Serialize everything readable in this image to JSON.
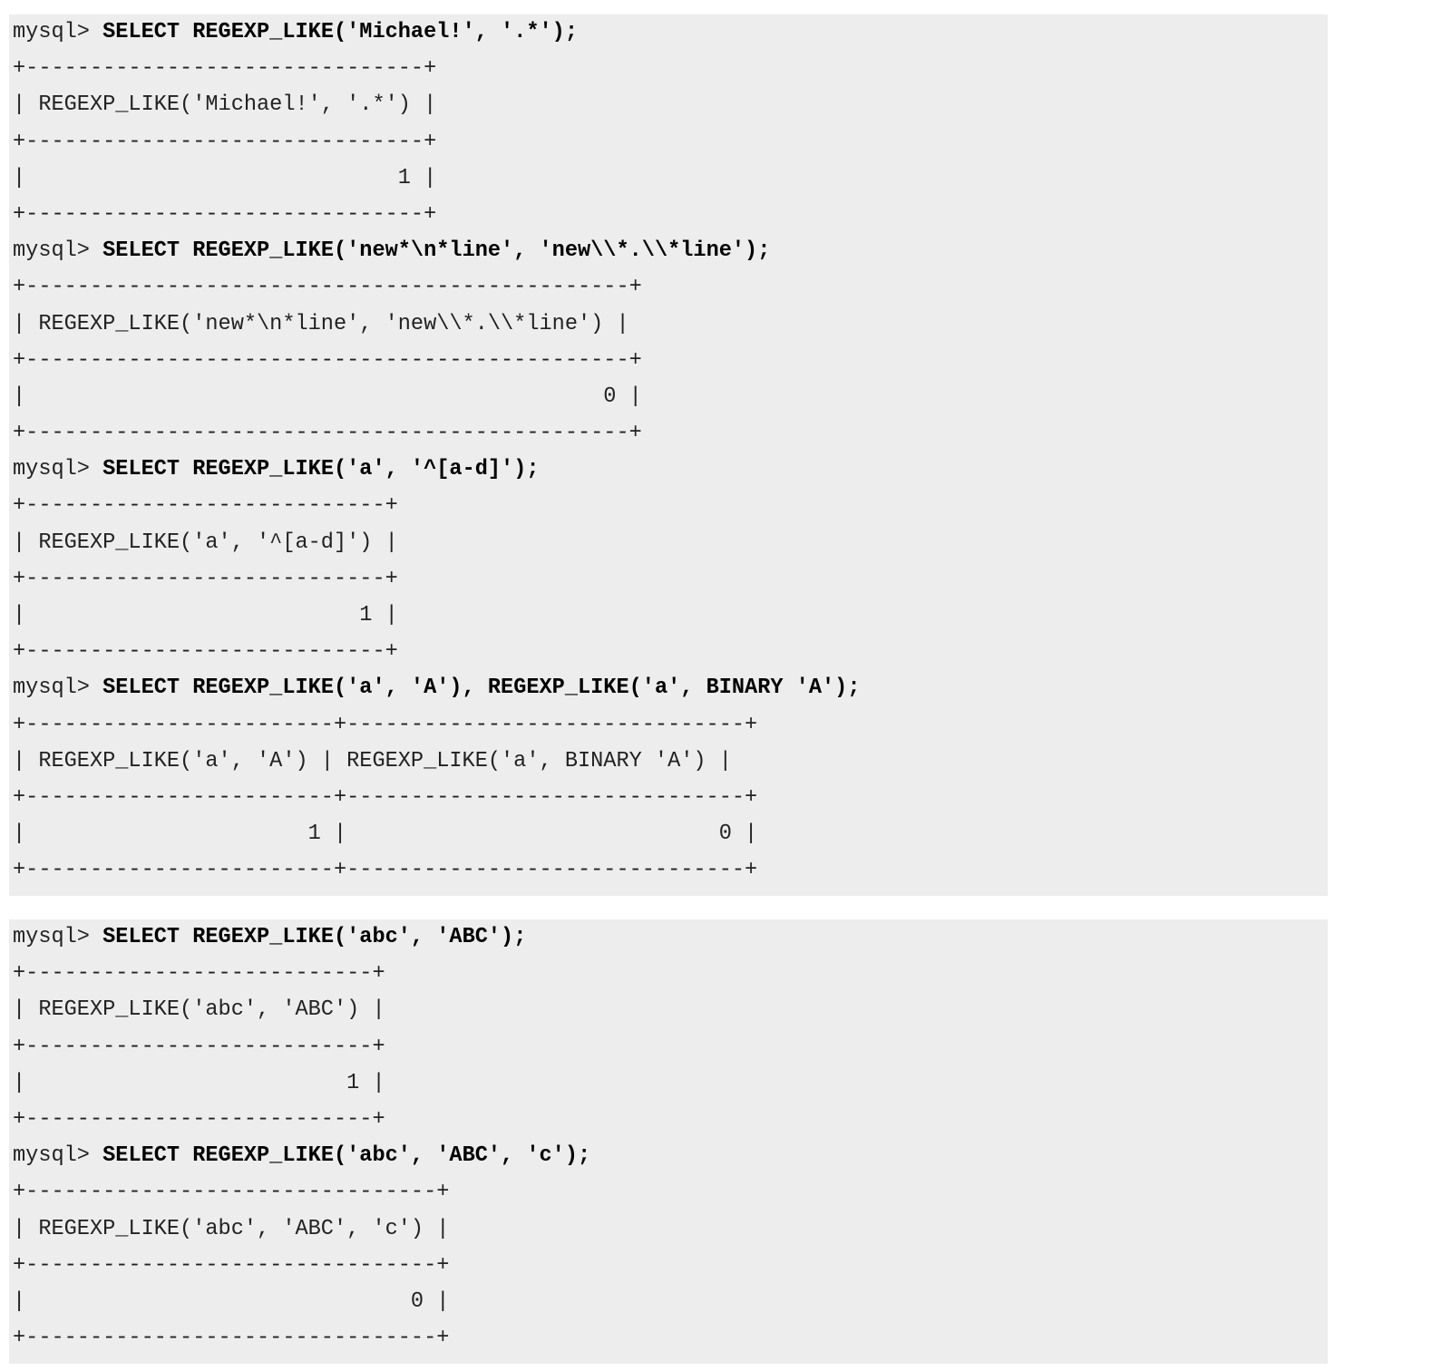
{
  "blocks": [
    {
      "lines": [
        {
          "prompt": "mysql> ",
          "command": "SELECT REGEXP_LIKE('Michael!', '.*');"
        },
        {
          "text": "+-------------------------------+"
        },
        {
          "text": "| REGEXP_LIKE('Michael!', '.*') |"
        },
        {
          "text": "+-------------------------------+"
        },
        {
          "text": "|                             1 |"
        },
        {
          "text": "+-------------------------------+"
        },
        {
          "prompt": "mysql> ",
          "command": "SELECT REGEXP_LIKE('new*\\n*line', 'new\\\\*.\\\\*line');"
        },
        {
          "text": "+-----------------------------------------------+"
        },
        {
          "text": "| REGEXP_LIKE('new*\\n*line', 'new\\\\*.\\\\*line') |"
        },
        {
          "text": "+-----------------------------------------------+"
        },
        {
          "text": "|                                             0 |"
        },
        {
          "text": "+-----------------------------------------------+"
        },
        {
          "prompt": "mysql> ",
          "command": "SELECT REGEXP_LIKE('a', '^[a-d]');"
        },
        {
          "text": "+----------------------------+"
        },
        {
          "text": "| REGEXP_LIKE('a', '^[a-d]') |"
        },
        {
          "text": "+----------------------------+"
        },
        {
          "text": "|                          1 |"
        },
        {
          "text": "+----------------------------+"
        },
        {
          "prompt": "mysql> ",
          "command": "SELECT REGEXP_LIKE('a', 'A'), REGEXP_LIKE('a', BINARY 'A');"
        },
        {
          "text": "+------------------------+-------------------------------+"
        },
        {
          "text": "| REGEXP_LIKE('a', 'A') | REGEXP_LIKE('a', BINARY 'A') |"
        },
        {
          "text": "+------------------------+-------------------------------+"
        },
        {
          "text": "|                      1 |                             0 |"
        },
        {
          "text": "+------------------------+-------------------------------+"
        }
      ]
    },
    {
      "lines": [
        {
          "prompt": "mysql> ",
          "command": "SELECT REGEXP_LIKE('abc', 'ABC');"
        },
        {
          "text": "+---------------------------+"
        },
        {
          "text": "| REGEXP_LIKE('abc', 'ABC') |"
        },
        {
          "text": "+---------------------------+"
        },
        {
          "text": "|                         1 |"
        },
        {
          "text": "+---------------------------+"
        },
        {
          "prompt": "mysql> ",
          "command": "SELECT REGEXP_LIKE('abc', 'ABC', 'c');"
        },
        {
          "text": "+--------------------------------+"
        },
        {
          "text": "| REGEXP_LIKE('abc', 'ABC', 'c') |"
        },
        {
          "text": "+--------------------------------+"
        },
        {
          "text": "|                              0 |"
        },
        {
          "text": "+--------------------------------+"
        }
      ]
    }
  ]
}
